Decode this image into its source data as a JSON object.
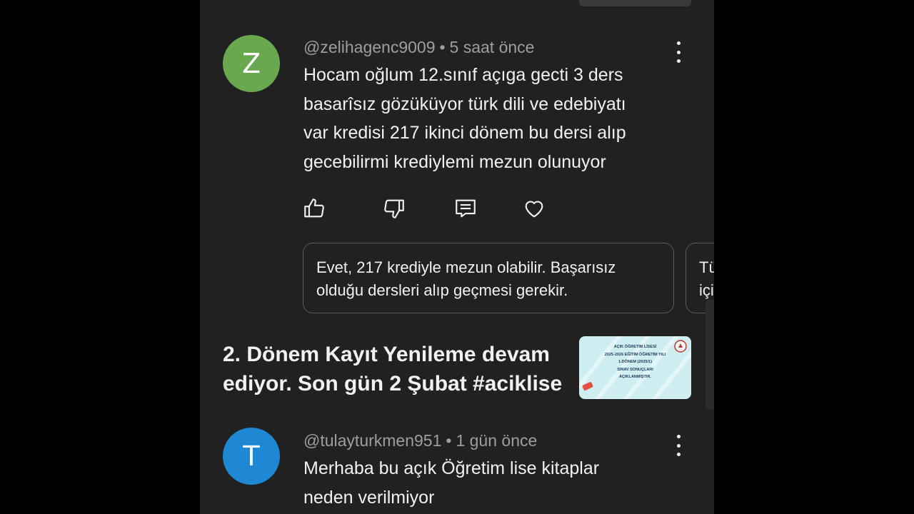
{
  "comment1": {
    "avatar_letter": "Z",
    "avatar_color": "#6aa84f",
    "username": "@zelihagenc9009",
    "separator": "•",
    "time": "5 saat önce",
    "text_lines": [
      "Hocam oğlum 12.sınıf açıga gecti 3 ders",
      "basarîsız gözüküyor  türk dili ve edebiyatı",
      "var kredisi 217 ikinci dönem bu dersi alıp",
      "gecebilirmi krediylemi mezun olunuyor"
    ]
  },
  "actions": {
    "like_icon": "thumbs-up-icon",
    "dislike_icon": "thumbs-down-icon",
    "reply_icon": "comment-icon",
    "heart_icon": "heart-icon"
  },
  "suggested_replies": [
    {
      "lines": [
        "Evet, 217 krediyle mezun olabilir. Başarısız",
        "olduğu dersleri alıp geçmesi gerekir."
      ]
    },
    {
      "lines": [
        "Tü",
        "içi"
      ]
    }
  ],
  "video": {
    "title_lines": [
      "2. Dönem Kayıt Yenileme devam",
      "ediyor. Son gün 2 Şubat #aciklise"
    ],
    "thumb_lines": [
      "AÇIK ÖĞRETİM LİSESİ",
      "2025-2026 EĞİTİM ÖĞRETİM YILI",
      "1.DÖNEM (2025/1)",
      "SINAV SONUÇLARI",
      "AÇIKLANMIŞTIR."
    ]
  },
  "comment2": {
    "avatar_letter": "T",
    "avatar_color": "#1e88d4",
    "username": "@tulayturkmen951",
    "separator": "•",
    "time": "1 gün önce",
    "text_lines": [
      "Merhaba bu açık Öğretim lise kitaplar",
      "neden verilmiyor"
    ]
  }
}
